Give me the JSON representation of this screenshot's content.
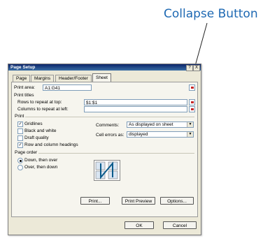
{
  "callout": "Collapse Button",
  "dialog": {
    "title": "Page Setup",
    "help_btn": "?",
    "close_btn": "X",
    "tabs": [
      "Page",
      "Margins",
      "Header/Footer",
      "Sheet"
    ],
    "print_area_label": "Print area:",
    "print_area_value": "A1:G41",
    "print_titles_label": "Print titles",
    "rows_label": "Rows to repeat at top:",
    "rows_value": "$1:$1",
    "cols_label": "Columns to repeat at left:",
    "cols_value": "",
    "print_label": "Print",
    "gridlines": "Gridlines",
    "black_white": "Black and white",
    "draft": "Draft quality",
    "row_col_headings": "Row and column headings",
    "comments_label": "Comments:",
    "comments_value": "As displayed on sheet",
    "cell_errors_label": "Cell errors as:",
    "cell_errors_value": "displayed",
    "page_order_label": "Page order",
    "down_then_over": "Down, then over",
    "over_then_down": "Over, then down",
    "print_btn": "Print...",
    "preview_btn": "Print Preview",
    "options_btn": "Options...",
    "ok_btn": "OK",
    "cancel_btn": "Cancel"
  },
  "colors": {
    "callout": "#1e69b3",
    "title_bar": "#0a246a",
    "collapse_icon": "#c62828"
  },
  "checks": {
    "gridlines": true,
    "black_white": false,
    "draft": false,
    "row_col_headings": true
  },
  "page_order_selected": "down_then_over"
}
